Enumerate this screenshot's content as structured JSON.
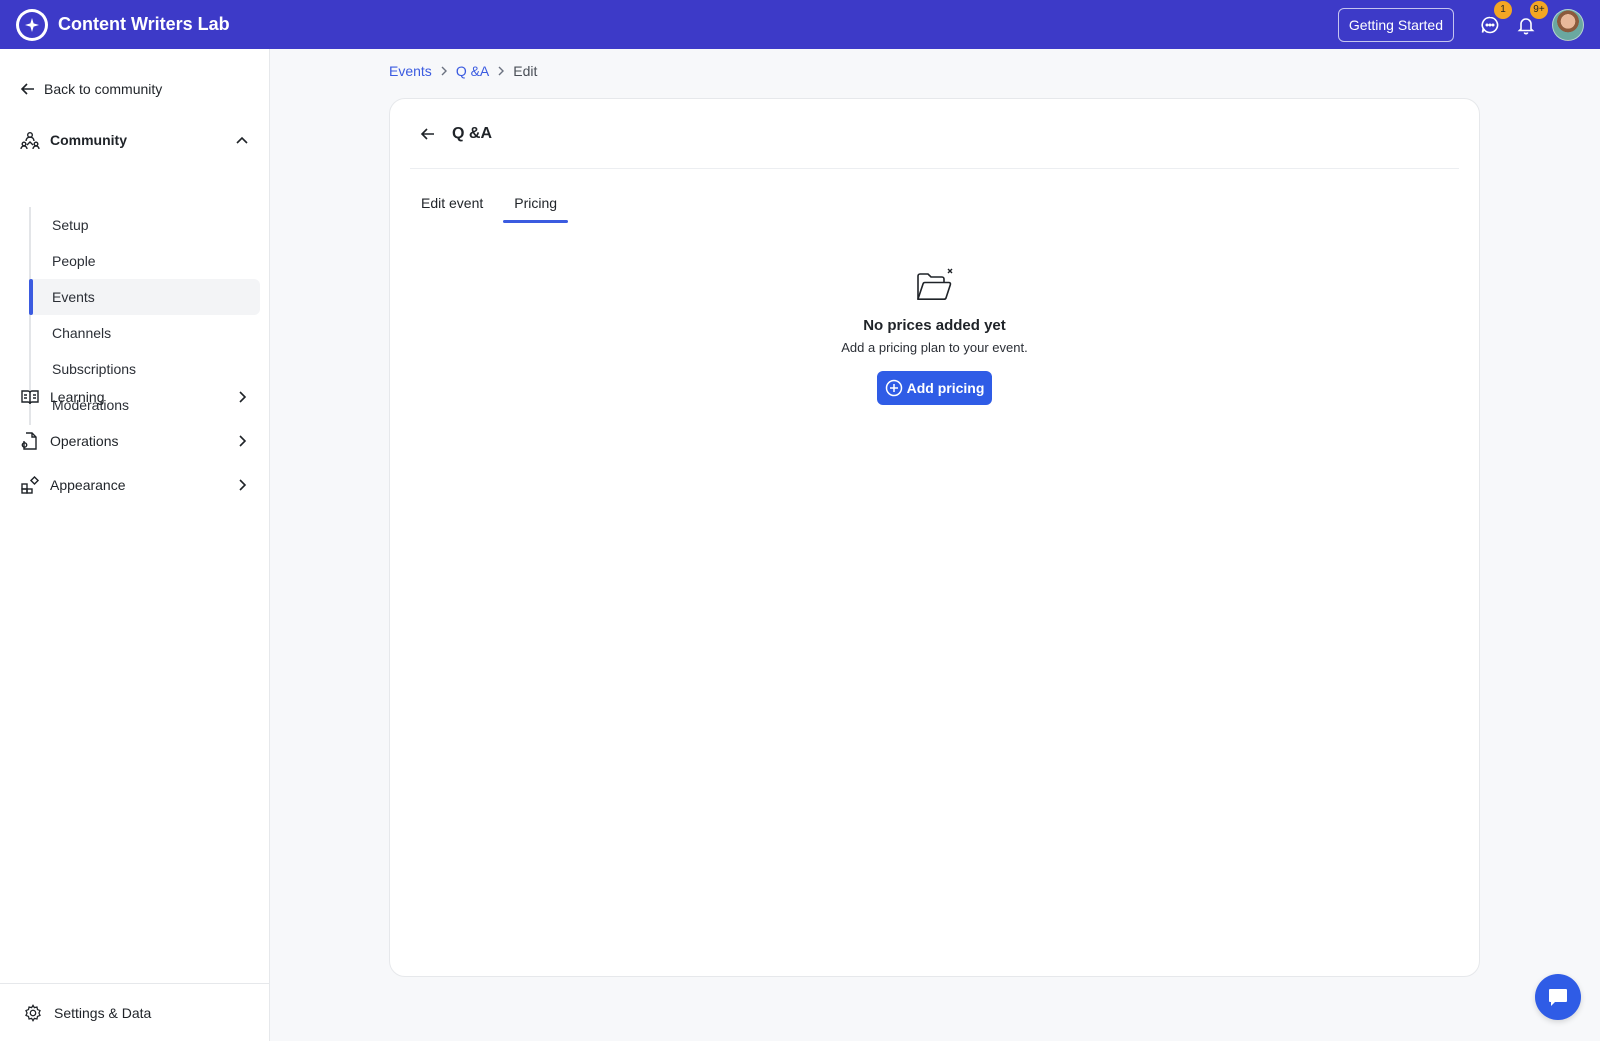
{
  "app": {
    "title": "Content Writers Lab",
    "logo_icon": "sparkle-icon",
    "brand_color": "#3d3ac8",
    "accent_color": "#2f5ce6"
  },
  "header": {
    "getting_started_label": "Getting Started",
    "messages_badge": "1",
    "notifications_badge": "9+"
  },
  "sidebar": {
    "back_label": "Back to community",
    "community_label": "Community",
    "community_items": [
      "Setup",
      "People",
      "Events",
      "Channels",
      "Subscriptions",
      "Moderations"
    ],
    "active_item": "Events",
    "sections": [
      {
        "label": "Learning",
        "icon": "book-icon"
      },
      {
        "label": "Operations",
        "icon": "document-icon"
      },
      {
        "label": "Appearance",
        "icon": "widgets-icon"
      }
    ],
    "settings_label": "Settings & Data"
  },
  "breadcrumb": {
    "items": [
      "Events",
      "Q &A",
      "Edit"
    ]
  },
  "card": {
    "title": "Q &A",
    "tabs": [
      "Edit event",
      "Pricing"
    ],
    "active_tab": "Pricing"
  },
  "empty_state": {
    "icon": "folder-open-icon",
    "title": "No prices added yet",
    "subtitle": "Add a pricing plan to your event.",
    "button_label": "Add pricing"
  }
}
